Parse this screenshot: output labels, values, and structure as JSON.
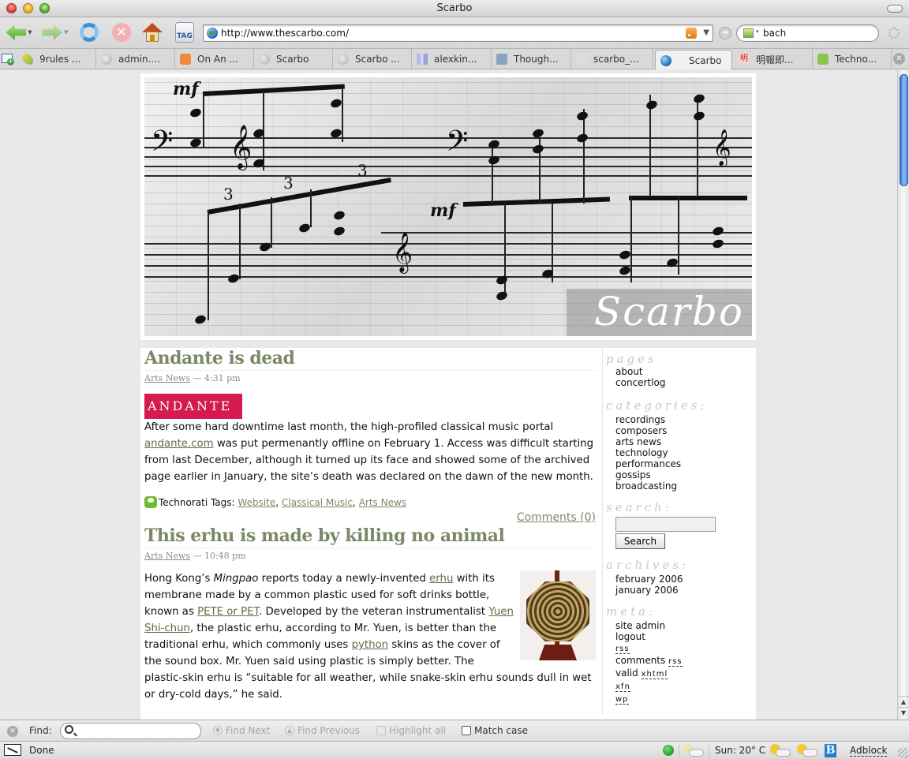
{
  "window": {
    "title": "Scarbo"
  },
  "toolbar": {
    "back_label": "Back",
    "forward_label": "Forward",
    "reload_label": "Reload",
    "stop_label": "Stop",
    "home_label": "Home",
    "tag_label": "TAG",
    "url": "http://www.thescarbo.com/",
    "search_value": "bach",
    "stop_glyph": "✕",
    "go_glyph": "➔",
    "dropdown_glyph": "▼",
    "small_dropdown_glyph": "▾"
  },
  "tabs": [
    {
      "label": "9rules ...",
      "icon": "leaf-icon",
      "active": false
    },
    {
      "label": "admin....",
      "icon": "default-page-icon",
      "active": false
    },
    {
      "label": "On An ...",
      "icon": "blogger-icon",
      "active": false
    },
    {
      "label": "Scarbo",
      "icon": "default-page-icon",
      "active": false
    },
    {
      "label": "Scarbo ...",
      "icon": "default-page-icon",
      "active": false
    },
    {
      "label": "alexkin...",
      "icon": "bars-icon",
      "active": false
    },
    {
      "label": "Though...",
      "icon": "star-icon",
      "active": false
    },
    {
      "label": "scarbo_...",
      "icon": "faint-page-icon",
      "active": false
    },
    {
      "label": "Scarbo",
      "icon": "globe-icon",
      "active": true
    },
    {
      "label": "明報即...",
      "icon": "mingpao-icon",
      "active": false
    },
    {
      "label": "Techno...",
      "icon": "technorati-icon",
      "active": false
    }
  ],
  "mingpao_glyph": "明",
  "close_glyph": "✕",
  "site": {
    "brand": "Scarbo",
    "header_image": {
      "dynamics": [
        "mf",
        "mf"
      ],
      "triplets": [
        "3",
        "3",
        "3"
      ],
      "bass_clef": "𝄢",
      "treble_clef": "𝄞"
    }
  },
  "posts": [
    {
      "title": "Andante is dead",
      "category": "Arts News",
      "separator": "—",
      "time": "4:31 pm",
      "logo_text": "ANDANTE",
      "body_before_link": "After some hard downtime last month, the high-profiled classical music portal ",
      "body_link": "andante.com",
      "body_after_link": " was put permenantly offline on February 1. Access was difficult starting from last December, although it turned up its face and showed some of the archived page earlier in January, the site’s death was declared on the dawn of the new month.",
      "tags_label": "Technorati Tags:",
      "tags": [
        "Website",
        "Classical Music",
        "Arts News"
      ],
      "comments": "Comments (0)"
    },
    {
      "title": "This erhu is made by killing no animal",
      "category": "Arts News",
      "separator": "—",
      "time": "10:48 pm",
      "body": {
        "p1": "Hong Kong’s ",
        "p1_em": "Mingpao",
        "p2": " reports today a newly-invented ",
        "link_erhu": "erhu",
        "p3": " with its membrane made by a common plastic used for soft drinks bottle, known as ",
        "link_pet": "PETE or PET",
        "p4": ". Developed by the veteran instrumentalist ",
        "link_yuen": "Yuen Shi-chun",
        "p5": ", the plastic erhu, according to Mr. Yuen, is better than the traditional erhu, which commonly uses ",
        "link_python": "python",
        "p6": " skins as the cover of the sound box. Mr. Yuen said using plastic is simply better. The plastic-skin erhu is “suitable for all weather, while snake-skin erhu sounds dull in wet or dry-cold days,” he said."
      }
    }
  ],
  "sidebar": {
    "pages_heading": "pages",
    "pages": [
      "about",
      "concertlog"
    ],
    "categories_heading": "categories:",
    "categories": [
      "recordings",
      "composers",
      "arts news",
      "technology",
      "performances",
      "gossips",
      "broadcasting"
    ],
    "search_heading": "search:",
    "search_value": "",
    "search_button": "Search",
    "archives_heading": "archives:",
    "archives": [
      "february 2006",
      "january 2006"
    ],
    "meta_heading": "meta:",
    "meta": {
      "site_admin": "site admin",
      "logout": "logout",
      "rss": "rss",
      "comments_prefix": "comments",
      "comments_rss": "rss",
      "valid_prefix": "valid",
      "xhtml": "xhtml",
      "xfn": "xfn",
      "wp": "wp"
    }
  },
  "findbar": {
    "label": "Find:",
    "value": "",
    "find_next": "Find Next",
    "find_previous": "Find Previous",
    "highlight_all": "Highlight all",
    "match_case": "Match case"
  },
  "statusbar": {
    "status": "Done",
    "weather": "Sun: 20° C",
    "b_label": "B",
    "adblock": "Adblock"
  },
  "colors": {
    "title_green": "#7b8866",
    "link_green": "#5d6f43",
    "andante_red": "#d41a4e",
    "sidebar_heading": "#c8c8c8",
    "scroll_blue": "#2b6cd5"
  }
}
